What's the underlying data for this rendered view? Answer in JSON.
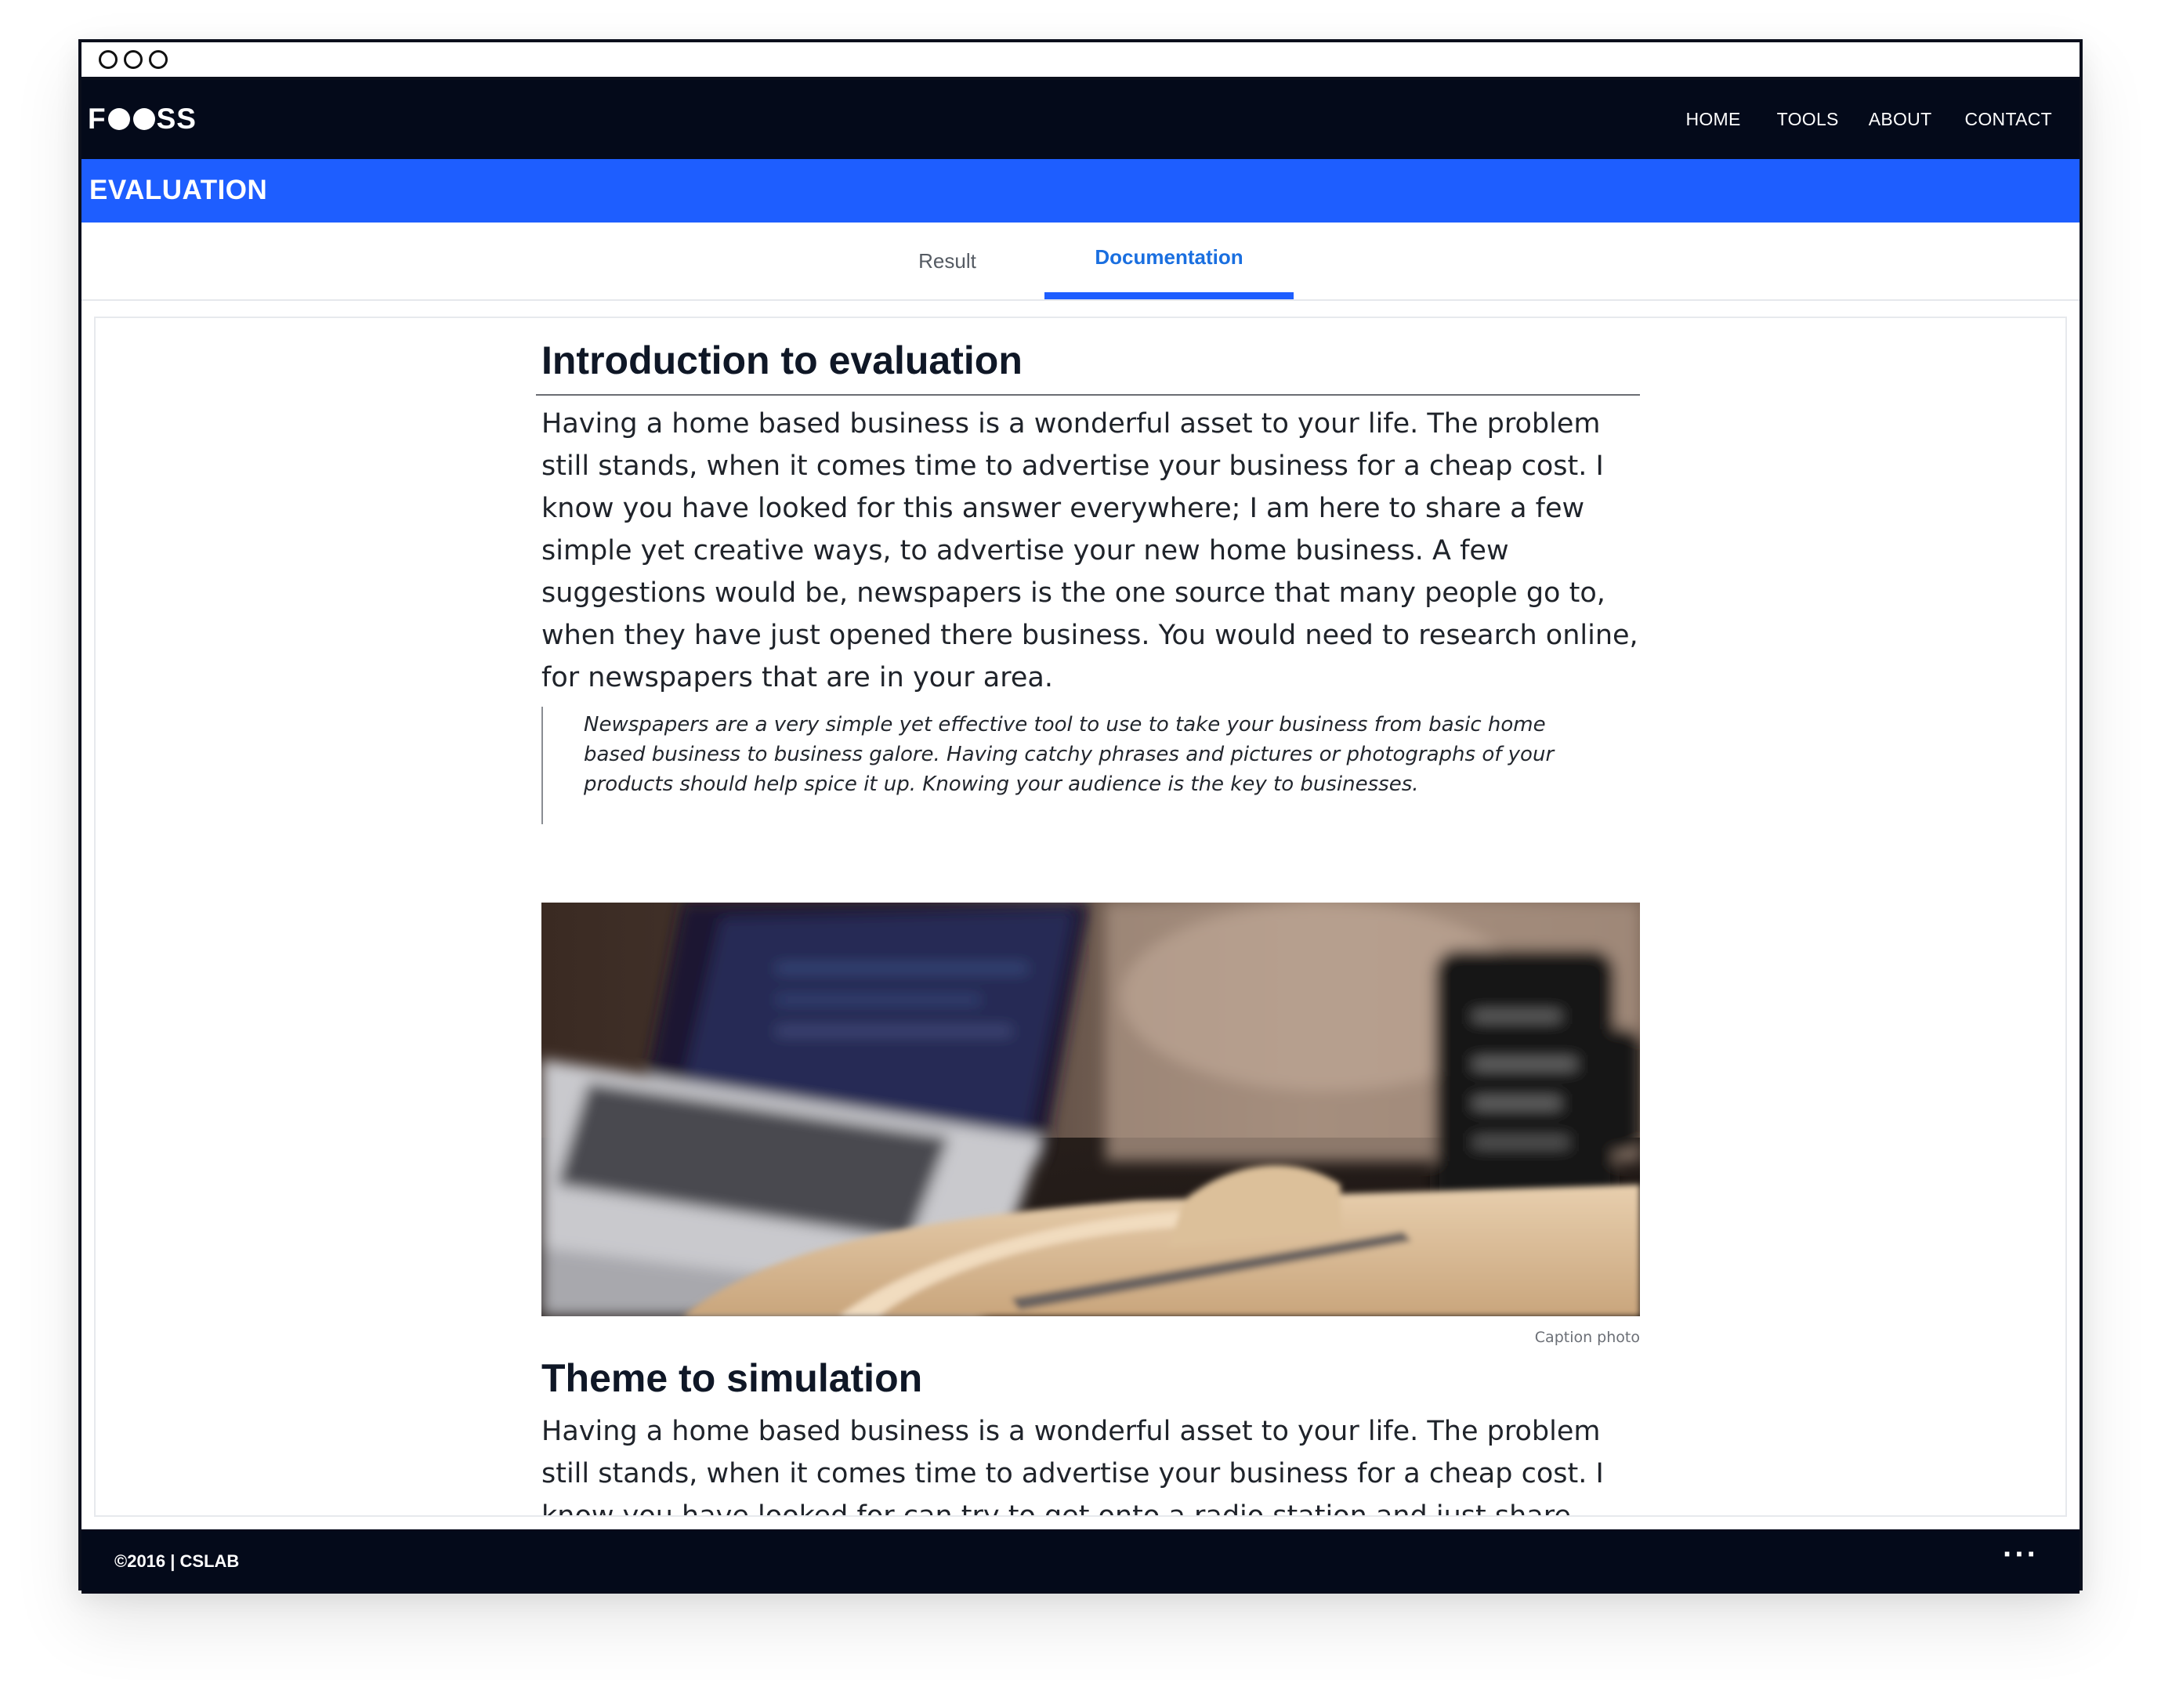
{
  "window": {
    "controls": [
      "window-dot-1",
      "window-dot-2",
      "window-dot-3"
    ]
  },
  "navbar": {
    "logo": {
      "pre": "F",
      "post": "SS"
    },
    "links": [
      "HOME",
      "TOOLS",
      "ABOUT",
      "CONTACT"
    ]
  },
  "banner": {
    "title": "EVALUATION"
  },
  "tabs": [
    {
      "label": "Result",
      "active": false
    },
    {
      "label": "Documentation",
      "active": true
    }
  ],
  "article": {
    "intro_heading": "Introduction to evaluation",
    "intro_paragraph": "Having a home based business is a wonderful asset to your life. The problem still stands, when it comes time to advertise your business for a cheap cost. I know you have looked for this answer everywhere; I am here to share a few simple yet creative ways, to advertise your new home business. A few suggestions would be, newspapers is the one source that many people go to, when they have just opened there business. You would need to research online, for newspapers that are in your area.",
    "quote": "Newspapers are a very simple yet effective tool to use to take your business from basic home based business to business galore. Having catchy phrases and pictures or photographs of your products should help spice it up. Knowing your audience is the key to businesses.",
    "photo_caption": "Caption photo",
    "theme_heading": "Theme to simulation",
    "theme_paragraph": "Having a home based business is a wonderful asset to your life. The problem still stands, when it comes time to advertise your business for a cheap cost. I know you have looked for can try to get onto a radio station and just share your business."
  },
  "footer": {
    "copyright": "©2016 |  CSLAB",
    "more": "···"
  },
  "colors": {
    "navbar": "#040a1a",
    "banner": "#1e5eff",
    "active_tab": "#1a6fe0"
  }
}
